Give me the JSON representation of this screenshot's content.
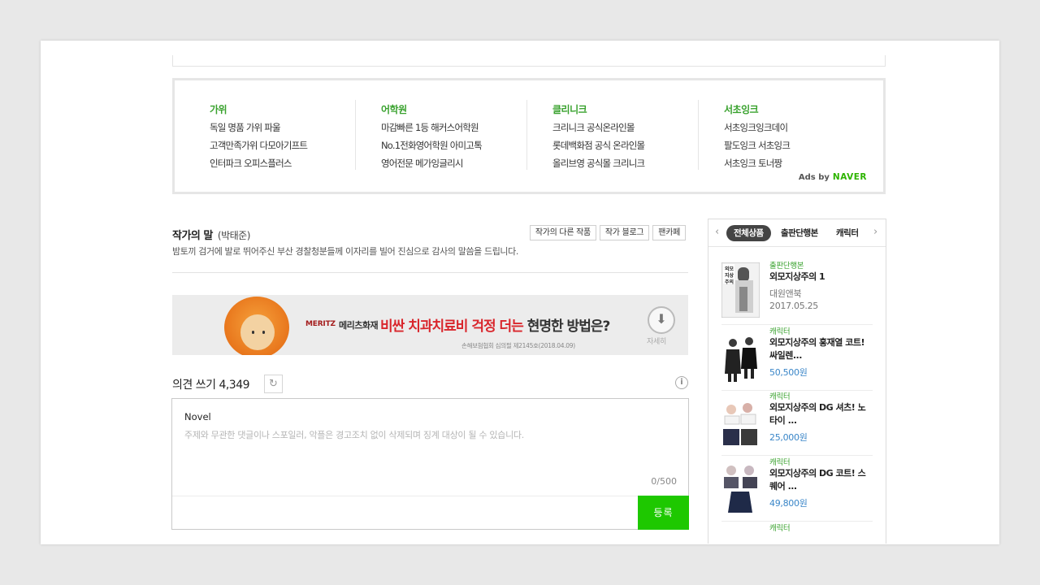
{
  "ads": {
    "columns": [
      {
        "category": "가위",
        "links": [
          "독일 명품 가위 파울",
          "고객만족가위 다모아기프트",
          "인터파크 오피스플러스"
        ]
      },
      {
        "category": "어학원",
        "links": [
          "마감빠른 1등 해커스어학원",
          "No.1전화영어학원 아미고톡",
          "영어전문 메가잉글리시"
        ]
      },
      {
        "category": "클리니크",
        "links": [
          "크리니크 공식온라인몰",
          "롯데백화점 공식 온라인몰",
          "올리브영 공식몰 크리니크"
        ]
      },
      {
        "category": "서초잉크",
        "links": [
          "서초잉크잉크데이",
          "팔도잉크 서초잉크",
          "서초잉크 토너짱"
        ]
      }
    ],
    "ads_by": "Ads by",
    "naver": "NAVER"
  },
  "author": {
    "title": "작가의 말",
    "name": "(박태준)",
    "buttons": [
      "작가의 다른 작품",
      "작가 블로그",
      "팬카페"
    ],
    "message": "밤토끼 검거에 발로 뛰어주신 부산 경찰청분들께 이자리를 빌어 진심으로 감사의 말씀을 드립니다."
  },
  "banner": {
    "brand": "MERITZ",
    "brand_kr": "메리츠화재",
    "headline_red": "비싼 치과치료비 걱정 더는",
    "headline_rest": " 현명한 방법은?",
    "fine_print": "손해보험협회 심의필 제2145호(2018.04.09)",
    "download_label": "자세히"
  },
  "comments": {
    "title": "의견 쓰기",
    "count": "4,349",
    "user": "Novel",
    "placeholder": "주제와 무관한 댓글이나 스포일러, 악플은 경고조치 없이 삭제되며 징계 대상이 될 수 있습니다.",
    "char_count": "0/500",
    "submit_label": "등록"
  },
  "sidebar": {
    "tabs": [
      "전체상품",
      "출판단행본",
      "캐릭터"
    ],
    "active_tab": "전체상품",
    "products": [
      {
        "category": "출판단행본",
        "title": "외모지상주의 1",
        "sub1": "대원앤북",
        "sub2": "2017.05.25"
      },
      {
        "category": "캐릭터",
        "title": "외모지상주의 홍재열 코트! 싸일렌...",
        "price": "50,500원"
      },
      {
        "category": "캐릭터",
        "title": "외모지상주의 DG 셔츠! 노타이 ...",
        "price": "25,000원"
      },
      {
        "category": "캐릭터",
        "title": "외모지상주의 DG 코트! 스퀘어 ...",
        "price": "49,800원"
      },
      {
        "category": "캐릭터"
      }
    ]
  },
  "colors": {
    "green": "#1ec800",
    "naver_green": "#2db400",
    "link_green": "#39a22e",
    "price_blue": "#3a86c8"
  }
}
